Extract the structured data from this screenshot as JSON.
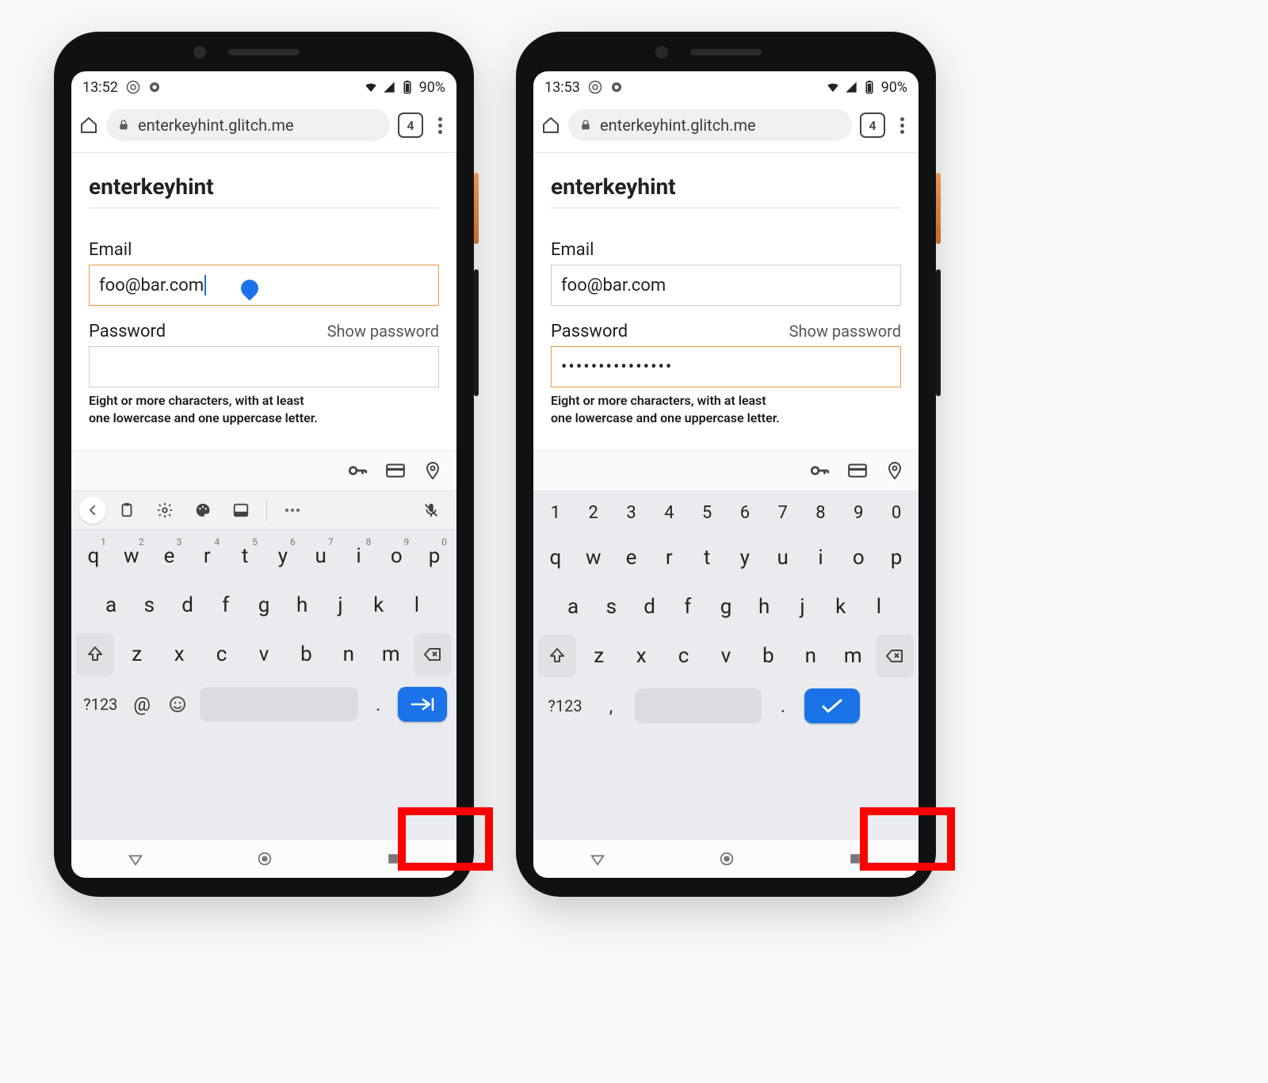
{
  "phones": [
    {
      "status": {
        "time": "13:52",
        "battery_text": "90%"
      },
      "browser": {
        "url": "enterkeyhint.glitch.me",
        "tab_count": "4"
      },
      "page": {
        "title": "enterkeyhint",
        "email_label": "Email",
        "email_value": "foo@bar.com",
        "email_focused": true,
        "password_label": "Password",
        "show_password": "Show password",
        "password_value": "",
        "password_focused": false,
        "hint_line1": "Eight or more characters, with at least",
        "hint_line2": "one lowercase and one uppercase letter."
      },
      "keyboard": {
        "variant": "email",
        "num_row": null,
        "row1": [
          "q",
          "w",
          "e",
          "r",
          "t",
          "y",
          "u",
          "i",
          "o",
          "p"
        ],
        "row1_sup": [
          "1",
          "2",
          "3",
          "4",
          "5",
          "6",
          "7",
          "8",
          "9",
          "0"
        ],
        "row2": [
          "a",
          "s",
          "d",
          "f",
          "g",
          "h",
          "j",
          "k",
          "l"
        ],
        "row3": [
          "z",
          "x",
          "c",
          "v",
          "b",
          "n",
          "m"
        ],
        "bottom": {
          "sym": "?123",
          "at": "@",
          "left_extra": "emoji",
          "period": ".",
          "enter_icon": "next"
        }
      }
    },
    {
      "status": {
        "time": "13:53",
        "battery_text": "90%"
      },
      "browser": {
        "url": "enterkeyhint.glitch.me",
        "tab_count": "4"
      },
      "page": {
        "title": "enterkeyhint",
        "email_label": "Email",
        "email_value": "foo@bar.com",
        "email_focused": false,
        "password_label": "Password",
        "show_password": "Show password",
        "password_value": "•••••••••••••••",
        "password_focused": true,
        "hint_line1": "Eight or more characters, with at least",
        "hint_line2": "one lowercase and one uppercase letter."
      },
      "keyboard": {
        "variant": "password",
        "num_row": [
          "1",
          "2",
          "3",
          "4",
          "5",
          "6",
          "7",
          "8",
          "9",
          "0"
        ],
        "row1": [
          "q",
          "w",
          "e",
          "r",
          "t",
          "y",
          "u",
          "i",
          "o",
          "p"
        ],
        "row1_sup": null,
        "row2": [
          "a",
          "s",
          "d",
          "f",
          "g",
          "h",
          "j",
          "k",
          "l"
        ],
        "row3": [
          "z",
          "x",
          "c",
          "v",
          "b",
          "n",
          "m"
        ],
        "bottom": {
          "sym": "?123",
          "at": ",",
          "left_extra": null,
          "period": ".",
          "enter_icon": "done"
        }
      }
    }
  ]
}
